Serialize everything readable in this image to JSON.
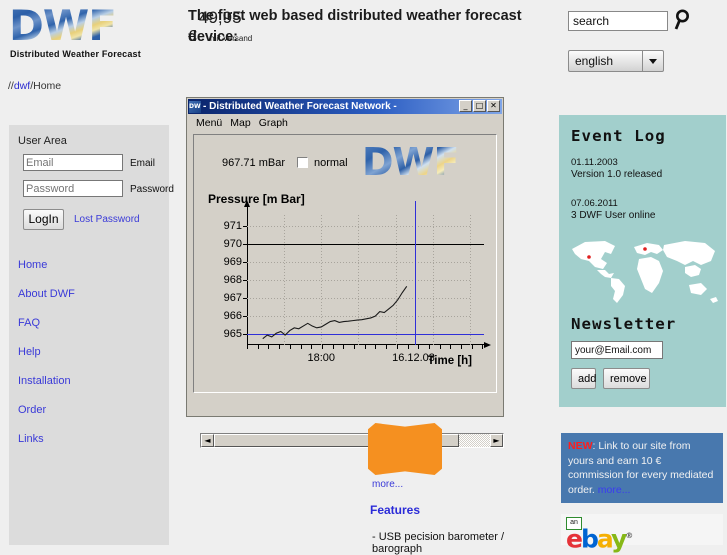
{
  "brand": {
    "logo_text": "DWF",
    "logo_subtitle": "Distributed Weather Forecast"
  },
  "breadcrumb": {
    "prefix": "//",
    "link": "dwf",
    "rest": "/Home"
  },
  "header": {
    "headline": "The first web based distributed weather forecast device:"
  },
  "search": {
    "value": "search",
    "placeholder": "search",
    "icon": "search-icon"
  },
  "language": {
    "selected": "english",
    "options": [
      "english"
    ]
  },
  "sidebar": {
    "title": "User Area",
    "email_label": "Email",
    "password_label": "Password",
    "email_value": "",
    "password_value": "",
    "login_label": "LogIn",
    "lost_password_label": "Lost Password",
    "nav": [
      {
        "label": "Home"
      },
      {
        "label": "About DWF"
      },
      {
        "label": "FAQ"
      },
      {
        "label": "Help"
      },
      {
        "label": "Installation"
      },
      {
        "label": "Order"
      },
      {
        "label": "Links"
      }
    ]
  },
  "app_window": {
    "title": "- Distributed Weather Forecast Network -",
    "icon": "dwf-app-icon",
    "minimize_label": "_",
    "maximize_label": "□",
    "close_label": "✕",
    "menus": [
      "Menü",
      "Map",
      "Graph"
    ],
    "pressure_readout": "967.71 mBar",
    "normal_checkbox_label": "normal",
    "normal_checked": false,
    "logo_text": "DWF",
    "scroll_left": "◄",
    "scroll_right": "►"
  },
  "chart_data": {
    "type": "line",
    "title": "Pressure [m Bar]",
    "xlabel": "Time [h]",
    "ylabel": "Pressure [m Bar]",
    "ylim": [
      964.4,
      971.6
    ],
    "yticks": [
      965,
      966,
      967,
      968,
      969,
      970,
      971
    ],
    "ytick_labels": [
      "965",
      "966",
      "967",
      "968",
      "969",
      "970",
      "971"
    ],
    "xticks": [
      "18:00",
      "16.12.03"
    ],
    "xtick_positions": [
      0.33,
      0.74
    ],
    "grid": true,
    "legend": "none",
    "annotations": [
      {
        "name": "upper-threshold-line",
        "type": "hline",
        "y": 970,
        "color": "#000000"
      },
      {
        "name": "lower-threshold-line",
        "type": "hline",
        "y": 965,
        "color": "#2f2fd8"
      },
      {
        "name": "cursor-line",
        "type": "vline",
        "x": 0.745,
        "color": "#2f2fd8"
      }
    ],
    "series": [
      {
        "name": "pressure",
        "color": "#1a1a1a",
        "x": [
          0.07,
          0.09,
          0.11,
          0.13,
          0.15,
          0.17,
          0.19,
          0.21,
          0.23,
          0.25,
          0.27,
          0.29,
          0.31,
          0.33,
          0.35,
          0.37,
          0.39,
          0.41,
          0.43,
          0.45,
          0.47,
          0.49,
          0.51,
          0.53,
          0.55,
          0.57,
          0.59,
          0.61,
          0.63,
          0.65,
          0.67,
          0.69,
          0.71
        ],
        "y": [
          964.75,
          964.95,
          964.85,
          965.05,
          965.15,
          964.95,
          965.2,
          965.35,
          965.3,
          965.45,
          965.6,
          965.45,
          965.35,
          965.4,
          965.55,
          965.7,
          965.75,
          965.65,
          965.7,
          965.72,
          965.75,
          965.78,
          965.8,
          965.85,
          965.9,
          966.0,
          966.25,
          966.2,
          966.4,
          966.6,
          966.9,
          967.3,
          967.65
        ]
      }
    ]
  },
  "price_tag": {
    "amount": "49,95",
    "currency": "€",
    "shipping_note": "mit Versand",
    "more_label": "more..."
  },
  "features": {
    "title": "Features",
    "items": [
      "- USB pecision barometer / barograph"
    ]
  },
  "event_log": {
    "title": "Event Log",
    "entries": [
      {
        "date": "01.11.2003",
        "text": "Version 1.0 released"
      },
      {
        "date": "07.06.2011",
        "text": "3 DWF User online"
      }
    ]
  },
  "newsletter": {
    "title": "Newsletter",
    "email_value": "your@Email.com",
    "email_placeholder": "your@Email.com",
    "add_label": "add",
    "remove_label": "remove"
  },
  "promo": {
    "badge": "NEW",
    "text": ": Link to our site from yours and earn 10 € commission for every mediated order. ",
    "more_label": "more..."
  },
  "ebay": {
    "prefix": "an",
    "letters": [
      "e",
      "b",
      "a",
      "y"
    ],
    "tm": "®"
  },
  "colors": {
    "page_bg": "#efefef",
    "sidebar_bg": "#dcdcdc",
    "teal_panel": "#a2cfcc",
    "promo_blue": "#4878ae",
    "price_orange": "#f59020",
    "link_blue": "#3a3ad8",
    "accent_red": "#ff1d1d"
  }
}
